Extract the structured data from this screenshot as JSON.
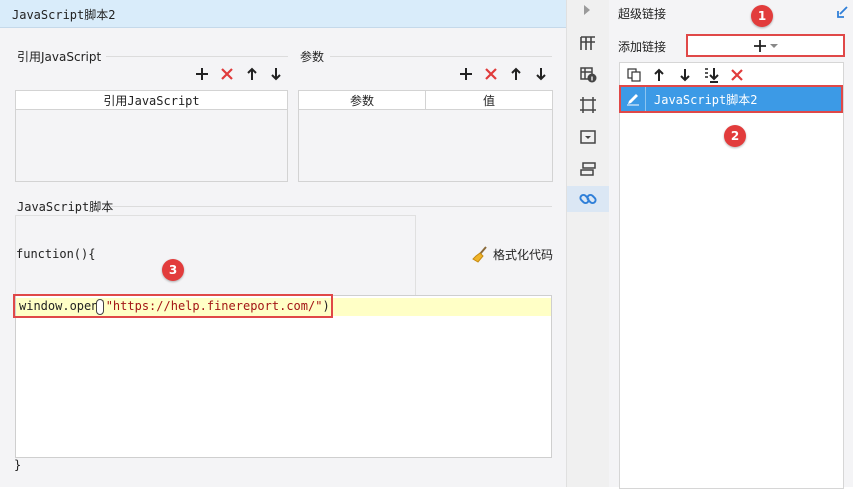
{
  "left_panel": {
    "title": "JavaScript脚本2",
    "ref_js": {
      "label": "引用JavaScript",
      "column": "引用JavaScript"
    },
    "params": {
      "label": "参数",
      "columns": [
        "参数",
        "值"
      ]
    },
    "script": {
      "label": "JavaScript脚本",
      "header_line": "function(){",
      "format_button": "格式化代码",
      "code_fn": "window.open(",
      "code_str": "\"https://help.finereport.com/\"",
      "code_close": ")",
      "footer_line": "}"
    }
  },
  "right_panel": {
    "title": "超级链接",
    "add_label": "添加链接",
    "links": [
      {
        "name": "JavaScript脚本2",
        "selected": true
      }
    ]
  },
  "markers": [
    "1",
    "2",
    "3"
  ],
  "icons": {
    "add": "plus-icon",
    "delete": "delete-icon",
    "up": "arrow-up-icon",
    "down": "arrow-down-icon",
    "copy": "copy-icon",
    "move-bottom": "move-to-bottom-icon",
    "format": "broom-icon",
    "edit": "pencil-icon",
    "confirm": "checkmark-icon"
  },
  "colors": {
    "title_bar": "#d9ecfa",
    "selected_row": "#3c9ae6",
    "highlight_line": "#ffffc6",
    "delete": "#e03b3b",
    "marker": "#e23c3c"
  }
}
